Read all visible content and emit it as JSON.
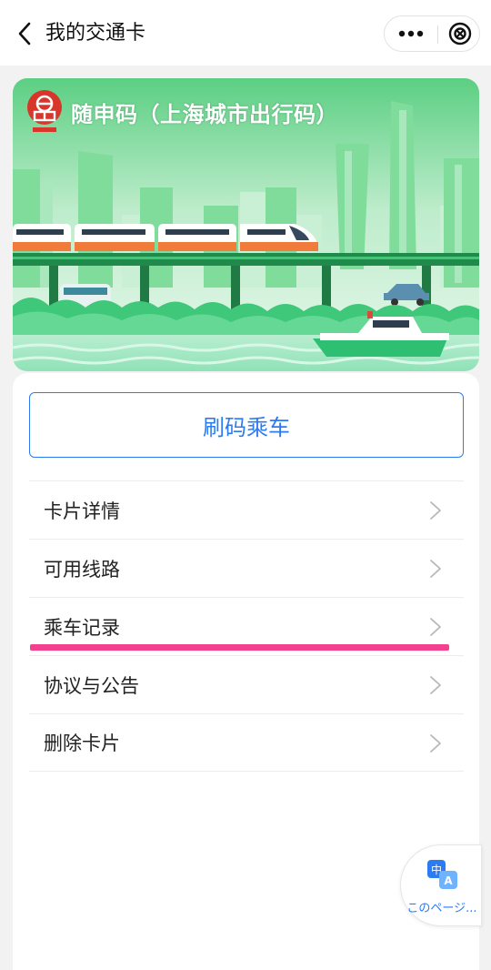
{
  "navbar": {
    "title": "我的交通卡",
    "back_icon": "chevron-left-icon",
    "more_icon": "more-dots-icon",
    "close_icon": "close-circle-icon"
  },
  "banner": {
    "title": "随申码（上海城市出行码）",
    "logo_icon": "shanghai-logo-icon"
  },
  "actions": {
    "primary_button": "刷码乘车"
  },
  "menu": {
    "items": [
      {
        "label": "卡片详情"
      },
      {
        "label": "可用线路"
      },
      {
        "label": "乘车记录"
      },
      {
        "label": "协议与公告"
      },
      {
        "label": "删除卡片"
      }
    ]
  },
  "translate": {
    "label": "このページ..."
  },
  "colors": {
    "accent": "#2d7bf2",
    "highlight": "#f2418f",
    "banner_green": "#4fd37a"
  }
}
